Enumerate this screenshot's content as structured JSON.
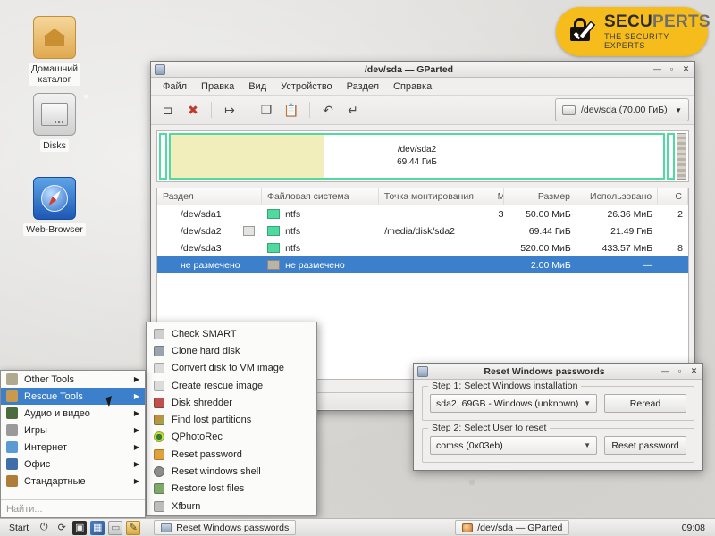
{
  "desktop": {
    "icons": [
      {
        "label": "Домашний\nкаталог",
        "label_l1": "Домашний",
        "label_l2": "каталог",
        "icon": "home-folder-icon"
      },
      {
        "label": "Disks",
        "icon": "disks-icon"
      },
      {
        "label": "Web-Browser",
        "icon": "web-browser-icon"
      }
    ]
  },
  "logo": {
    "title_main": "SECU",
    "title_alt": "PERTS",
    "tagline": "THE SECURITY EXPERTS",
    "brand_color": "#f5bc1c",
    "icon": "lock-check-icon"
  },
  "gparted": {
    "title": "/dev/sda — GParted",
    "window_icon": "gparted-icon",
    "window_buttons": {
      "minimize": "—",
      "maximize": "▫",
      "close": "✕"
    },
    "menu": [
      "Файл",
      "Правка",
      "Вид",
      "Устройство",
      "Раздел",
      "Справка"
    ],
    "toolbar": [
      {
        "name": "new-partition-button",
        "glyph": "⊐"
      },
      {
        "name": "delete-partition-button",
        "glyph": "✖"
      },
      {
        "name": "resize-move-button",
        "glyph": "↦"
      },
      {
        "name": "copy-button",
        "glyph": "❐"
      },
      {
        "name": "paste-button",
        "glyph": "📋"
      },
      {
        "name": "undo-button",
        "glyph": "↶"
      },
      {
        "name": "apply-button",
        "glyph": "↵"
      }
    ],
    "device_selector": {
      "label": "/dev/sda  (70.00 ГиБ)",
      "arrow": "▼"
    },
    "graphic": {
      "partition_name": "/dev/sda2",
      "partition_size": "69.44 ГиБ",
      "used_percent": 31
    },
    "table": {
      "headers": [
        "Раздел",
        "Файловая система",
        "Точка монтирования",
        "Метка",
        "Размер",
        "Использовано",
        "С"
      ],
      "rows": [
        {
          "partition": "/dev/sda1",
          "fs": "ntfs",
          "mount": "",
          "label": "Зарезервировано системой",
          "size": "50.00 МиБ",
          "used": "26.36 МиБ",
          "free": "2",
          "selected": false,
          "has_mini_icon": false
        },
        {
          "partition": "/dev/sda2",
          "fs": "ntfs",
          "mount": "/media/disk/sda2",
          "label": "",
          "size": "69.44 ГиБ",
          "used": "21.49 ГиБ",
          "free": "",
          "selected": false,
          "has_mini_icon": true
        },
        {
          "partition": "/dev/sda3",
          "fs": "ntfs",
          "mount": "",
          "label": "",
          "size": "520.00 МиБ",
          "used": "433.57 МиБ",
          "free": "8",
          "selected": false,
          "has_mini_icon": false
        },
        {
          "partition": "не размечено",
          "fs": "не размечено",
          "mount": "",
          "label": "",
          "size": "2.00 МиБ",
          "used": "—",
          "free": "",
          "selected": true,
          "has_mini_icon": false
        }
      ]
    }
  },
  "reset_dialog": {
    "title": "Reset Windows passwords",
    "window_icon": "window-icon",
    "window_buttons": {
      "minimize": "—",
      "maximize": "▫",
      "close": "✕"
    },
    "step1": {
      "legend": "Step 1: Select Windows installation",
      "combo_value": "sda2, 69GB - Windows (unknown)",
      "combo_arrow": "▼",
      "button": "Reread"
    },
    "step2": {
      "legend": "Step 2: Select User to reset",
      "combo_value": "comss (0x03eb)",
      "combo_arrow": "▼",
      "button": "Reset password"
    }
  },
  "start_menu": {
    "items": [
      {
        "label": "Other Tools",
        "icon": "folder-tools-icon",
        "color": "#b0a98f",
        "caret": "▶",
        "selected": false
      },
      {
        "label": "Rescue Tools",
        "icon": "folder-rescue-icon",
        "color": "#c99a4e",
        "caret": "▶",
        "selected": true
      },
      {
        "label": "Аудио и видео",
        "icon": "multimedia-icon",
        "color": "#4c6b3e",
        "caret": "▶",
        "selected": false
      },
      {
        "label": "Игры",
        "icon": "games-icon",
        "color": "#9a9a9a",
        "caret": "▶",
        "selected": false
      },
      {
        "label": "Интернет",
        "icon": "internet-icon",
        "color": "#5b9bd5",
        "caret": "▶",
        "selected": false
      },
      {
        "label": "Офис",
        "icon": "office-icon",
        "color": "#3f6ea8",
        "caret": "▶",
        "selected": false
      },
      {
        "label": "Стандартные",
        "icon": "accessories-icon",
        "color": "#b07c3a",
        "caret": "▶",
        "selected": false
      }
    ],
    "search_placeholder": "Найти..."
  },
  "rescue_submenu": {
    "items": [
      {
        "label": "Check SMART",
        "icon": "drive-icon",
        "color": "#cfcfcf"
      },
      {
        "label": "Clone hard disk",
        "icon": "clone-disk-icon",
        "color": "#9aa4ae"
      },
      {
        "label": "Convert disk to VM image",
        "icon": "vm-image-icon",
        "color": "#dcdcdc"
      },
      {
        "label": "Create rescue image",
        "icon": "rescue-image-icon",
        "color": "#dcdcdc"
      },
      {
        "label": "Disk shredder",
        "icon": "shredder-icon",
        "color": "#c0504d"
      },
      {
        "label": "Find lost partitions",
        "icon": "find-partitions-icon",
        "color": "#e07b39"
      },
      {
        "label": "QPhotoRec",
        "icon": "qphotorec-icon",
        "color": "#2e7d32"
      },
      {
        "label": "Reset password",
        "icon": "reset-password-icon",
        "color": "#e0a33c"
      },
      {
        "label": "Reset windows shell",
        "icon": "reset-shell-icon",
        "color": "#8d8d8d"
      },
      {
        "label": "Restore lost files",
        "icon": "restore-files-icon",
        "color": "#7fa86b"
      },
      {
        "label": "Xfburn",
        "icon": "xfburn-icon",
        "color": "#bdbdbd"
      }
    ]
  },
  "taskbar": {
    "start_label": "Start",
    "launchers": [
      {
        "name": "shutdown-icon",
        "glyph": "⏻"
      },
      {
        "name": "restart-icon",
        "glyph": "⟳"
      },
      {
        "name": "terminal-icon",
        "glyph": "▣"
      },
      {
        "name": "applications-icon",
        "glyph": "▦"
      },
      {
        "name": "display-icon",
        "glyph": "▭"
      },
      {
        "name": "text-editor-icon",
        "glyph": "✎"
      }
    ],
    "tasks": [
      {
        "label": "Reset Windows passwords",
        "icon": "window-icon"
      },
      {
        "label": "/dev/sda — GParted",
        "icon": "gparted-icon"
      }
    ],
    "clock": "09:08"
  }
}
